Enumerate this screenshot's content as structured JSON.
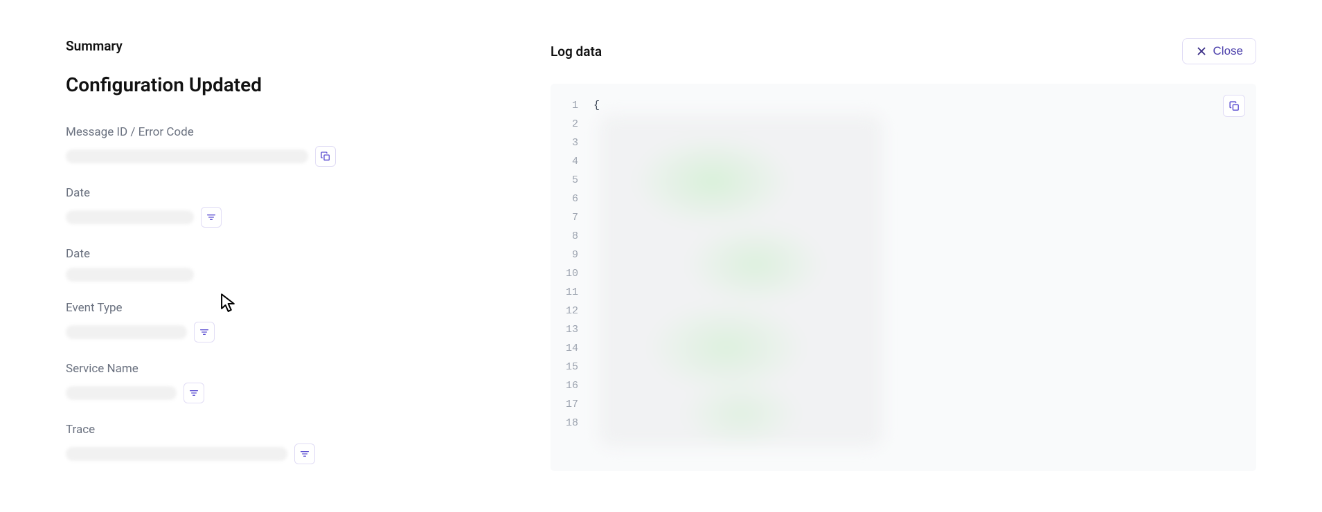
{
  "summary": {
    "header": "Summary",
    "title": "Configuration Updated",
    "fields": {
      "message_id": {
        "label": "Message ID / Error Code"
      },
      "date1": {
        "label": "Date"
      },
      "date2": {
        "label": "Date"
      },
      "event_type": {
        "label": "Event Type"
      },
      "service_name": {
        "label": "Service Name"
      },
      "trace": {
        "label": "Trace"
      }
    }
  },
  "logdata": {
    "header": "Log data",
    "close_label": "Close",
    "line1_content": "{",
    "line_numbers": [
      "1",
      "2",
      "3",
      "4",
      "5",
      "6",
      "7",
      "8",
      "9",
      "10",
      "11",
      "12",
      "13",
      "14",
      "15",
      "16",
      "17",
      "18"
    ]
  }
}
